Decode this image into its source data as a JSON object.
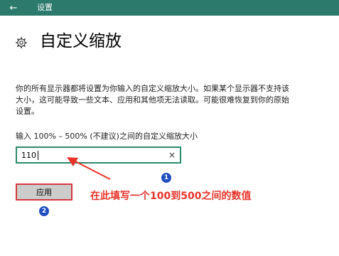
{
  "titlebar": {
    "back_icon": "←",
    "label": "设置",
    "color": "#2b7a6b"
  },
  "page": {
    "title": "自定义缩放"
  },
  "description": "你的所有显示器都将设置为你输入的自定义缩放大小。如果某个显示器不支持该大小，这可能导致一些文本、应用和其他项无法读取。可能很难恢复到你的原始设置。",
  "scale_field": {
    "label": "输入 100% – 500% (不建议)之间的自定义缩放大小",
    "value": "110",
    "clear_icon": "×",
    "border_color": "#2b8a6b"
  },
  "apply_button": {
    "label": "应用"
  },
  "annotations": {
    "badge_1": "1",
    "badge_2": "2",
    "text": "在此填写一个100到500之间的数值",
    "color": "#e8332a",
    "badge_color": "#1f4fbf"
  }
}
